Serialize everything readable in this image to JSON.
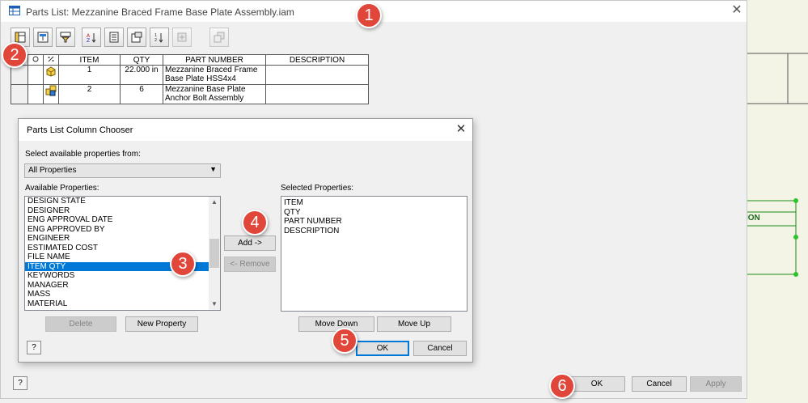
{
  "window": {
    "title": "Parts List: Mezzanine Braced Frame Base Plate Assembly.iam",
    "close_glyph": "✕"
  },
  "toolbar": {
    "icons": [
      "column-chooser-icon",
      "group-settings-icon",
      "filter-settings-icon",
      "sort-icon",
      "export-icon",
      "table-layout-icon",
      "renumber-items-icon",
      "add-vault-item-icon",
      "member-assembly-icon"
    ]
  },
  "parts_table": {
    "headers": [
      "ITEM",
      "QTY",
      "PART NUMBER",
      "DESCRIPTION"
    ],
    "rows": [
      {
        "item": "1",
        "qty": "22.000 in",
        "part_number": "Mezzanine Braced Frame Base Plate HSS4x4",
        "description": ""
      },
      {
        "item": "2",
        "qty": "6",
        "part_number": "Mezzanine Base Plate Anchor Bolt Assembly",
        "description": ""
      }
    ]
  },
  "chooser": {
    "title": "Parts List Column Chooser",
    "close_glyph": "✕",
    "select_from_label": "Select available properties from:",
    "select_value": "All Properties",
    "available_label": "Available Properties:",
    "selected_label": "Selected Properties:",
    "available_items": [
      "DESIGN STATE",
      "DESIGNER",
      "ENG APPROVAL DATE",
      "ENG APPROVED BY",
      "ENGINEER",
      "ESTIMATED COST",
      "FILE NAME",
      "ITEM QTY",
      "KEYWORDS",
      "MANAGER",
      "MASS",
      "MATERIAL"
    ],
    "selected_available": "ITEM QTY",
    "selected_items": [
      "ITEM",
      "QTY",
      "PART NUMBER",
      "DESCRIPTION"
    ],
    "add_label": "Add ->",
    "remove_label": "<- Remove",
    "delete_label": "Delete",
    "new_property_label": "New Property",
    "move_down_label": "Move Down",
    "move_up_label": "Move Up",
    "ok_label": "OK",
    "cancel_label": "Cancel"
  },
  "footer": {
    "ok_label": "OK",
    "cancel_label": "Cancel",
    "apply_label": "Apply"
  },
  "help_glyph": "?",
  "background": {
    "fragment_text": "ION"
  },
  "markers": [
    "1",
    "2",
    "3",
    "4",
    "5",
    "6"
  ],
  "colors": {
    "marker": "#e0463a",
    "selection": "#0078d7",
    "drawing_line": "#1a8a1a"
  }
}
